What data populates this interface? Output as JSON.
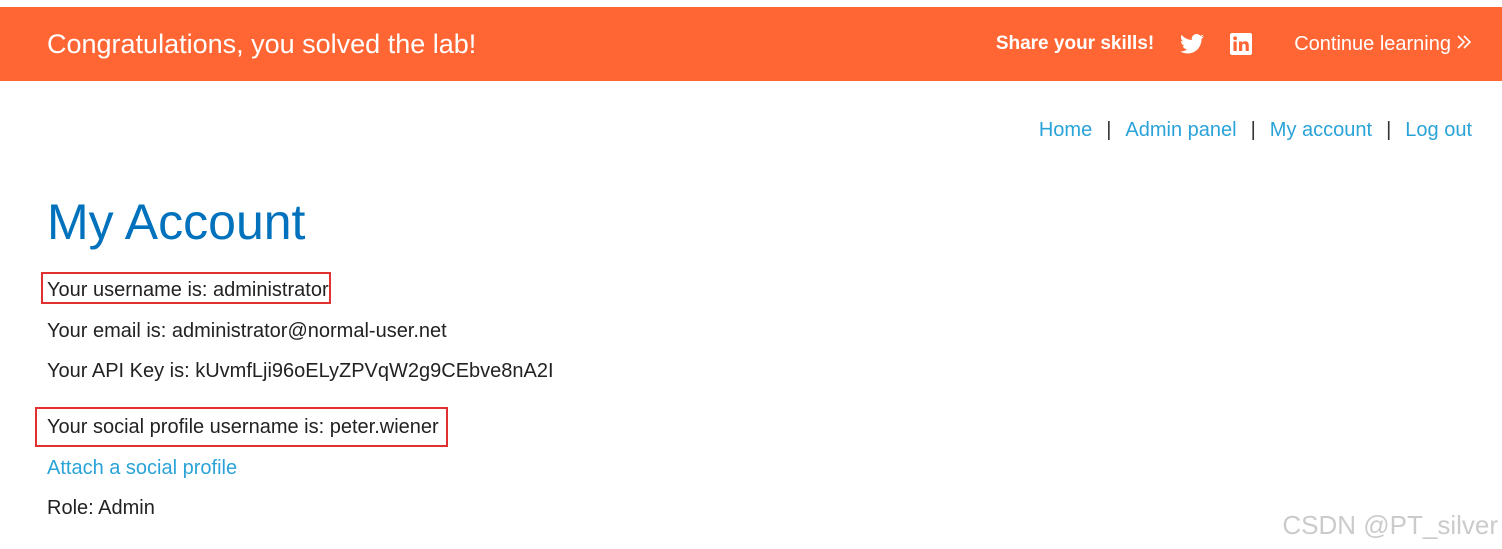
{
  "banner": {
    "title": "Congratulations, you solved the lab!",
    "share_label": "Share your skills!",
    "twitter_icon": "twitter-icon",
    "linkedin_icon": "linkedin-icon",
    "continue_label": "Continue learning",
    "continue_icon": "double-chevron-right-icon",
    "background": "#ff6633"
  },
  "nav": {
    "items": [
      {
        "label": "Home"
      },
      {
        "label": "Admin panel"
      },
      {
        "label": "My account"
      },
      {
        "label": "Log out"
      }
    ],
    "separator": "|",
    "link_color": "#29a3d8"
  },
  "page": {
    "title": "My Account",
    "title_color": "#0071bc",
    "username_line": "Your username is: administrator",
    "email_line": "Your email is: administrator@normal-user.net",
    "api_key_line": "Your API Key is: kUvmfLji96oELyZPVqW2g9CEbve8nA2I",
    "social_line": "Your social profile username is: peter.wiener",
    "attach_link": "Attach a social profile",
    "role_line": "Role: Admin"
  },
  "highlight_color": "#e03030",
  "watermark": "CSDN @PT_silver"
}
